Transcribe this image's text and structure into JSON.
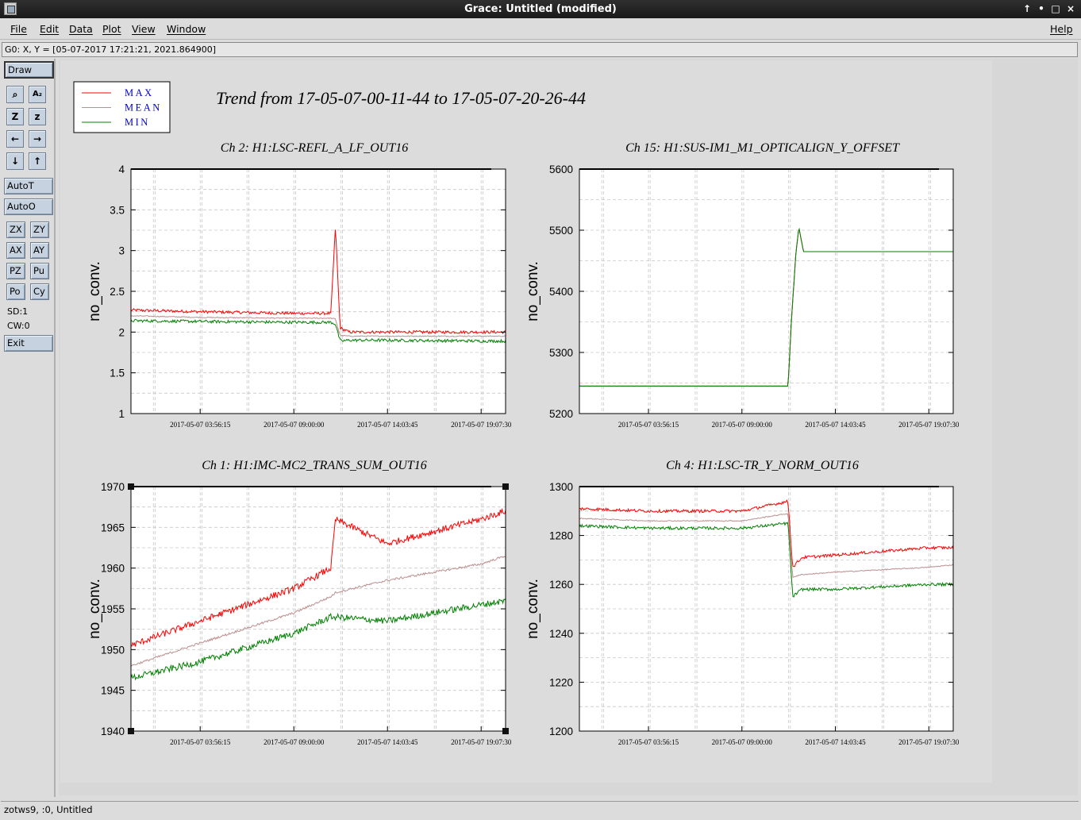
{
  "window": {
    "title": "Grace: Untitled (modified)"
  },
  "menubar": {
    "items": [
      "File",
      "Edit",
      "Data",
      "Plot",
      "View",
      "Window"
    ],
    "help": "Help"
  },
  "locator": {
    "text": "G0: X, Y = [05-07-2017 17:21:21, 2021.864900]"
  },
  "toolbar": {
    "draw": "Draw",
    "icons": [
      "zoom-icon",
      "text-icon",
      "zoom-in-z-icon",
      "zoom-out-z-icon",
      "arrow-left-icon",
      "arrow-right-icon",
      "arrow-down-icon",
      "arrow-up-icon"
    ],
    "icon_glyphs": [
      "⌕",
      "A₂",
      "Z",
      "z",
      "←",
      "→",
      "↓",
      "↑"
    ],
    "autot": "AutoT",
    "autoo": "AutoO",
    "grid": [
      "ZX",
      "ZY",
      "AX",
      "AY",
      "PZ",
      "Pu",
      "Po",
      "Cy"
    ],
    "sd": "SD:1",
    "cw": "CW:0",
    "exit": "Exit"
  },
  "statusbar": {
    "text": "zotws9, :0, Untitled"
  },
  "colors": {
    "max": "#ff0000",
    "mean": "#bc8f8f",
    "min": "#008000",
    "legend_text": "#0000cc"
  },
  "chart_title": "Trend from 17-05-07-00-11-44 to 17-05-07-20-26-44",
  "legend": [
    "MAX",
    "MEAN",
    "MIN"
  ],
  "chart_data": [
    {
      "type": "line",
      "title": "Ch 2: H1:LSC-REFL_A_LF_OUT16",
      "ylabel": "no_conv.",
      "ylim": [
        1,
        4
      ],
      "yticks": [
        "1",
        "1.5",
        "2",
        "2.5",
        "3",
        "3.5",
        "4"
      ],
      "xticks": [
        "2017-05-07 03:56:15",
        "2017-05-07 09:00:00",
        "2017-05-07 14:03:45",
        "2017-05-07 19:07:30"
      ],
      "x": [
        "00:11",
        "03:56",
        "09:00",
        "11:00",
        "11:15",
        "11:30",
        "12:00",
        "14:03",
        "19:07",
        "20:26"
      ],
      "series": [
        {
          "name": "MAX",
          "values": [
            2.27,
            2.25,
            2.23,
            2.23,
            3.3,
            2.05,
            2.0,
            2.0,
            2.0,
            2.0
          ]
        },
        {
          "name": "MEAN",
          "values": [
            2.2,
            2.18,
            2.17,
            2.17,
            2.16,
            1.96,
            1.95,
            1.95,
            1.95,
            1.95
          ]
        },
        {
          "name": "MIN",
          "values": [
            2.14,
            2.13,
            2.12,
            2.12,
            2.1,
            1.89,
            1.9,
            1.9,
            1.89,
            1.89
          ]
        }
      ]
    },
    {
      "type": "line",
      "title": "Ch 15: H1:SUS-IM1_M1_OPTICALIGN_Y_OFFSET",
      "ylabel": "no_conv.",
      "ylim": [
        5200,
        5600
      ],
      "yticks": [
        "5200",
        "5300",
        "5400",
        "5500",
        "5600"
      ],
      "xticks": [
        "2017-05-07 03:56:15",
        "2017-05-07 09:00:00",
        "2017-05-07 14:03:45",
        "2017-05-07 19:07:30"
      ],
      "x": [
        "00:11",
        "11:30",
        "11:40",
        "11:55",
        "12:05",
        "12:20",
        "20:26"
      ],
      "series": [
        {
          "name": "MAX",
          "values": [
            5245,
            5245,
            5345,
            5460,
            5505,
            5465,
            5465
          ]
        },
        {
          "name": "MEAN",
          "values": [
            5245,
            5245,
            5345,
            5460,
            5505,
            5465,
            5465
          ]
        },
        {
          "name": "MIN",
          "values": [
            5245,
            5245,
            5345,
            5460,
            5505,
            5465,
            5465
          ]
        }
      ]
    },
    {
      "type": "line",
      "title": "Ch 1: H1:IMC-MC2_TRANS_SUM_OUT16",
      "ylabel": "no_conv.",
      "ylim": [
        1940,
        1970
      ],
      "yticks": [
        "1940",
        "1945",
        "1950",
        "1955",
        "1960",
        "1965",
        "1970"
      ],
      "xticks": [
        "2017-05-07 03:56:15",
        "2017-05-07 09:00:00",
        "2017-05-07 14:03:45",
        "2017-05-07 19:07:30"
      ],
      "x": [
        "00:11",
        "03:56",
        "09:00",
        "11:00",
        "11:15",
        "14:03",
        "19:07",
        "20:26"
      ],
      "series": [
        {
          "name": "MAX",
          "values": [
            1950.5,
            1953.5,
            1957.5,
            1960,
            1966,
            1963,
            1966,
            1967
          ]
        },
        {
          "name": "MEAN",
          "values": [
            1948,
            1950.8,
            1954.5,
            1956.5,
            1957,
            1958.5,
            1960.5,
            1961.5
          ]
        },
        {
          "name": "MIN",
          "values": [
            1946.5,
            1948.5,
            1952,
            1954,
            1954,
            1953.5,
            1955.5,
            1956
          ]
        }
      ]
    },
    {
      "type": "line",
      "title": "Ch 4: H1:LSC-TR_Y_NORM_OUT16",
      "ylabel": "no_conv.",
      "ylim": [
        1200,
        1300
      ],
      "yticks": [
        "1200",
        "1220",
        "1240",
        "1260",
        "1280",
        "1300"
      ],
      "xticks": [
        "2017-05-07 03:56:15",
        "2017-05-07 09:00:00",
        "2017-05-07 14:03:45",
        "2017-05-07 19:07:30"
      ],
      "x": [
        "00:11",
        "03:56",
        "09:00",
        "11:30",
        "11:45",
        "12:15",
        "14:03",
        "19:07",
        "20:26"
      ],
      "series": [
        {
          "name": "MAX",
          "values": [
            1291,
            1290,
            1290,
            1294,
            1267,
            1271,
            1272,
            1275,
            1275
          ]
        },
        {
          "name": "MEAN",
          "values": [
            1287,
            1286,
            1286,
            1289,
            1263,
            1264,
            1265,
            1267,
            1268
          ]
        },
        {
          "name": "MIN",
          "values": [
            1284,
            1283,
            1283,
            1285,
            1255,
            1258,
            1258,
            1260,
            1260
          ]
        }
      ]
    }
  ]
}
